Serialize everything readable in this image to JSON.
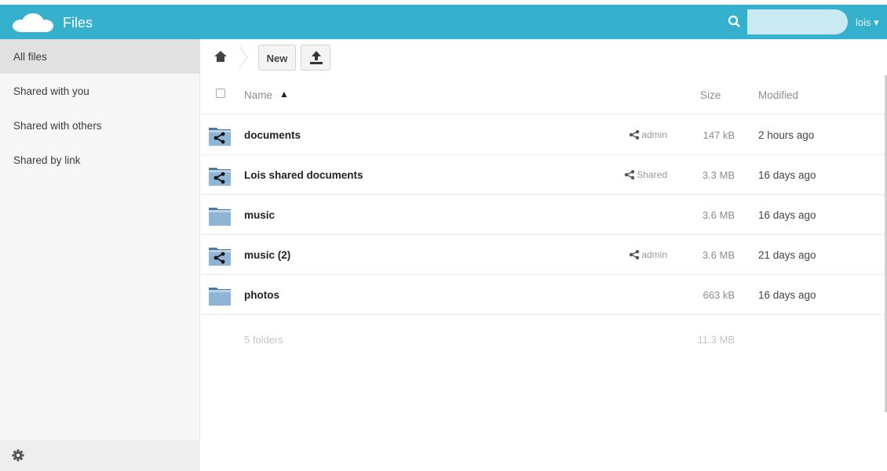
{
  "header": {
    "app_title": "Files",
    "user_label": "lois ▾",
    "search_placeholder": ""
  },
  "sidebar": {
    "items": [
      {
        "label": "All files",
        "active": true
      },
      {
        "label": "Shared with you"
      },
      {
        "label": "Shared with others"
      },
      {
        "label": "Shared by link"
      }
    ]
  },
  "controls": {
    "new_label": "New"
  },
  "list": {
    "columns": {
      "name": "Name",
      "sort_arrow": "▲",
      "size": "Size",
      "modified": "Modified"
    },
    "rows": [
      {
        "name": "documents",
        "shared": true,
        "share_label": "admin",
        "size": "147 kB",
        "modified": "2 hours ago"
      },
      {
        "name": "Lois shared documents",
        "shared": true,
        "share_label": "Shared",
        "size": "3.3 MB",
        "modified": "16 days ago"
      },
      {
        "name": "music",
        "shared": false,
        "share_label": "",
        "size": "3.6 MB",
        "modified": "16 days ago"
      },
      {
        "name": "music (2)",
        "shared": true,
        "share_label": "admin",
        "size": "3.6 MB",
        "modified": "21 days ago"
      },
      {
        "name": "photos",
        "shared": false,
        "share_label": "",
        "size": "663 kB",
        "modified": "16 days ago"
      }
    ],
    "summary": {
      "count": "5 folders",
      "total": "11.3 MB"
    }
  },
  "colors": {
    "accent": "#35b1ce"
  }
}
